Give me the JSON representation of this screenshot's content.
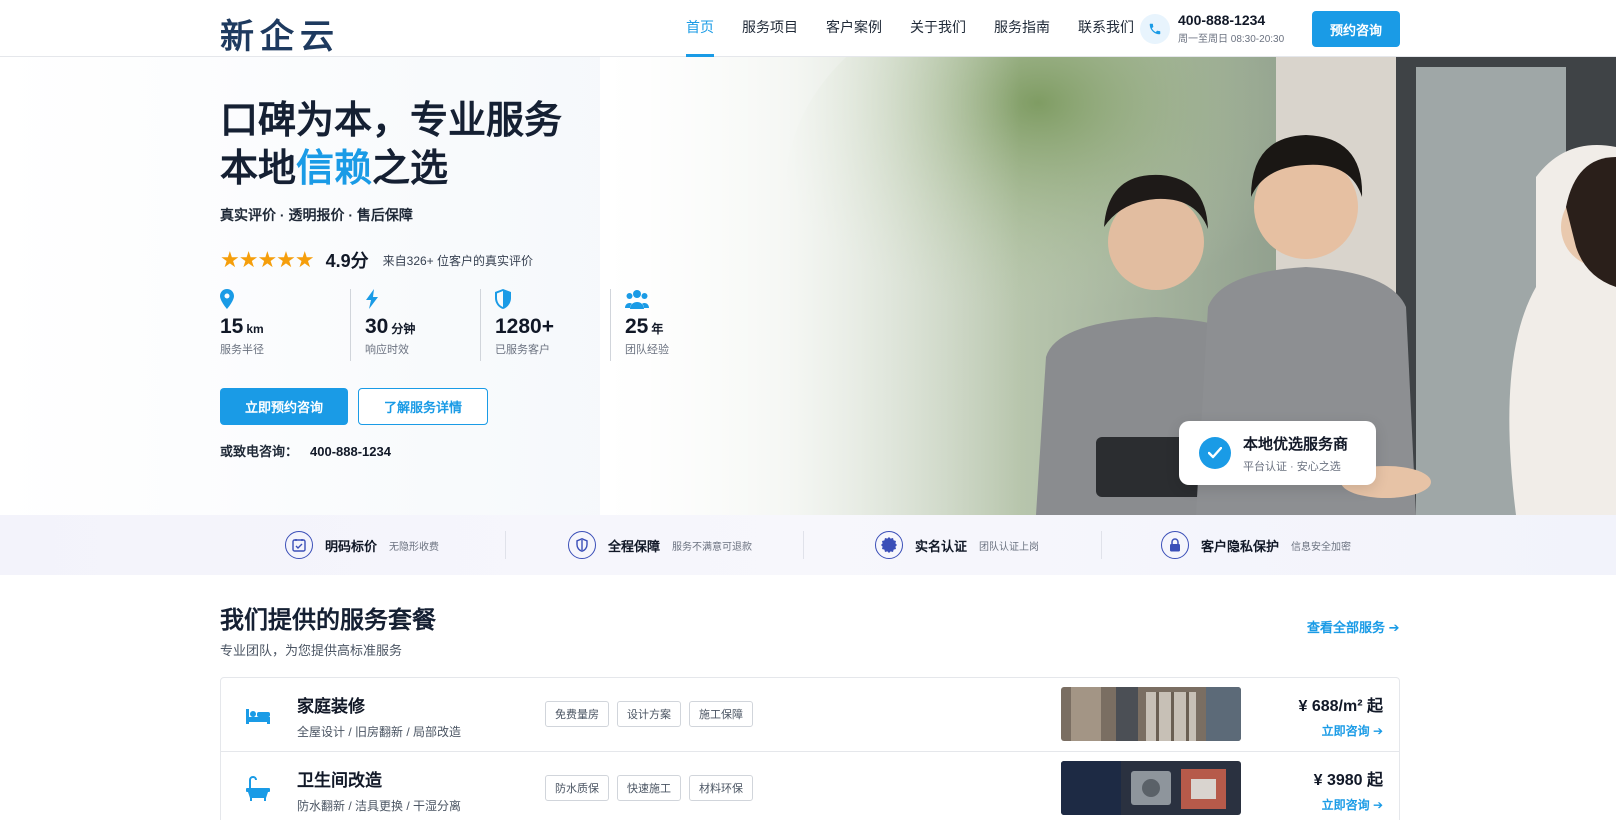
{
  "header": {
    "logo": "新企云",
    "nav": [
      "首页",
      "服务项目",
      "客户案例",
      "关于我们",
      "服务指南",
      "联系我们"
    ],
    "active_nav": "首页",
    "phone": "400-888-1234",
    "hours": "周一至周日 08:30-20:30",
    "cta": "预约咨询"
  },
  "hero": {
    "title_line1": "口碑为本，专业服务",
    "title_line2_pre": "本地",
    "title_line2_highlight": "信赖",
    "title_line2_post": "之选",
    "subline": "真实评价 · 透明报价 · 售后保障",
    "stars": "★★★★★",
    "rating": "4.9分",
    "reviews": "来自326+ 位客户的真实评价",
    "stats": [
      {
        "icon": "location-pin-icon",
        "value": "15",
        "unit": "km",
        "label": "服务半径"
      },
      {
        "icon": "lightning-icon",
        "value": "30",
        "unit": "分钟",
        "label": "响应时效"
      },
      {
        "icon": "shield-icon",
        "value": "1280+",
        "unit": "",
        "label": "已服务客户"
      },
      {
        "icon": "team-icon",
        "value": "25",
        "unit": "年",
        "label": "团队经验"
      }
    ],
    "primary_button": "立即预约咨询",
    "secondary_button": "了解服务详情",
    "call_label": "或致电咨询：",
    "call_number": "400-888-1234",
    "badge_title": "本地优选服务商",
    "badge_sub": "平台认证 · 安心之选"
  },
  "trust": [
    {
      "icon": "calendar-check-icon",
      "title": "明码标价",
      "sub": "无隐形收费"
    },
    {
      "icon": "shield-icon",
      "title": "全程保障",
      "sub": "服务不满意可退款"
    },
    {
      "icon": "verified-badge-icon",
      "title": "实名认证",
      "sub": "团队认证上岗"
    },
    {
      "icon": "lock-icon",
      "title": "客户隐私保护",
      "sub": "信息安全加密"
    }
  ],
  "services": {
    "title": "我们提供的服务套餐",
    "subtitle": "专业团队，为您提供高标准服务",
    "view_all": "查看全部服务 ➔",
    "items": [
      {
        "icon": "bed-icon",
        "name": "家庭装修",
        "desc": "全屋设计 / 旧房翻新 / 局部改造",
        "tags": [
          "免费量房",
          "设计方案",
          "施工保障"
        ],
        "price": "¥ 688/m² 起",
        "link": "立即咨询 ➔"
      },
      {
        "icon": "bathtub-icon",
        "name": "卫生间改造",
        "desc": "防水翻新 / 洁具更换 / 干湿分离",
        "tags": [
          "防水质保",
          "快速施工",
          "材料环保"
        ],
        "price": "¥ 3980 起",
        "link": "立即咨询 ➔"
      }
    ]
  },
  "colors": {
    "accent": "#1a9be6",
    "navy": "#1e3a5f",
    "star": "#f59e0b"
  }
}
